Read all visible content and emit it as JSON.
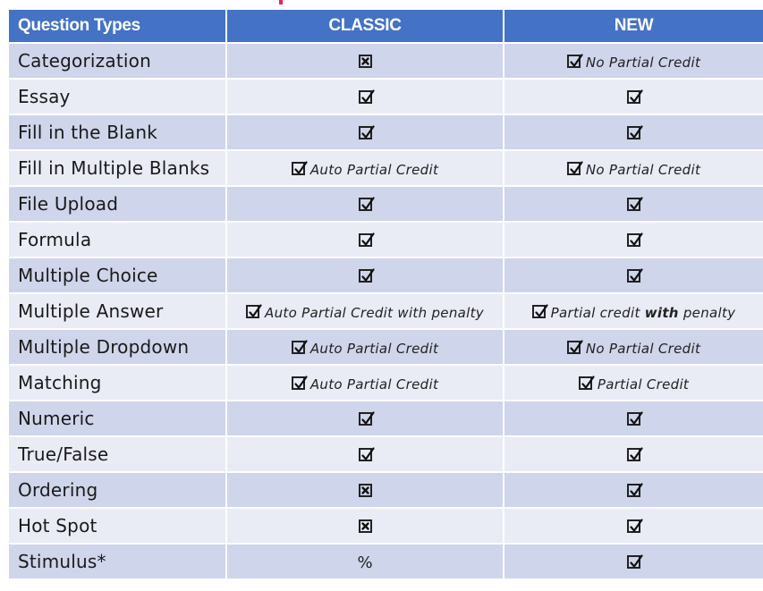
{
  "header": {
    "col_question": "Question Types",
    "col_classic": "CLASSIC",
    "col_new": "NEW"
  },
  "colors": {
    "header_bg": "#4472c4",
    "row_odd": "#cfd5ea",
    "row_even": "#e9ebf5",
    "title_accent": "#e8245a"
  },
  "icons": {
    "supported": "check-box-icon",
    "unsupported": "x-box-icon"
  },
  "rows": [
    {
      "name": "Categorization",
      "classic": {
        "mark": "x",
        "note": ""
      },
      "new": {
        "mark": "check",
        "note": "No Partial Credit"
      }
    },
    {
      "name": "Essay",
      "classic": {
        "mark": "check",
        "note": ""
      },
      "new": {
        "mark": "check",
        "note": ""
      }
    },
    {
      "name": "Fill in the Blank",
      "classic": {
        "mark": "check",
        "note": ""
      },
      "new": {
        "mark": "check",
        "note": ""
      }
    },
    {
      "name": "Fill in Multiple Blanks",
      "classic": {
        "mark": "check",
        "note": "Auto Partial Credit"
      },
      "new": {
        "mark": "check",
        "note": "No Partial Credit"
      }
    },
    {
      "name": "File Upload",
      "classic": {
        "mark": "check",
        "note": ""
      },
      "new": {
        "mark": "check",
        "note": ""
      }
    },
    {
      "name": "Formula",
      "classic": {
        "mark": "check",
        "note": ""
      },
      "new": {
        "mark": "check",
        "note": ""
      }
    },
    {
      "name": "Multiple Choice",
      "classic": {
        "mark": "check",
        "note": ""
      },
      "new": {
        "mark": "check",
        "note": ""
      }
    },
    {
      "name": "Multiple Answer",
      "classic": {
        "mark": "check",
        "note": "Auto Partial Credit with penalty"
      },
      "new": {
        "mark": "check",
        "note_pre": "Partial credit ",
        "note_bold": "with",
        "note_post": " penalty"
      }
    },
    {
      "name": "Multiple Dropdown",
      "classic": {
        "mark": "check",
        "note": "Auto Partial Credit"
      },
      "new": {
        "mark": "check",
        "note": "No Partial Credit"
      }
    },
    {
      "name": "Matching",
      "classic": {
        "mark": "check",
        "note": "Auto Partial Credit"
      },
      "new": {
        "mark": "check",
        "note": "Partial Credit"
      }
    },
    {
      "name": "Numeric",
      "classic": {
        "mark": "check",
        "note": ""
      },
      "new": {
        "mark": "check",
        "note": ""
      }
    },
    {
      "name": "True/False",
      "classic": {
        "mark": "check",
        "note": ""
      },
      "new": {
        "mark": "check",
        "note": ""
      }
    },
    {
      "name": "Ordering",
      "classic": {
        "mark": "x",
        "note": ""
      },
      "new": {
        "mark": "check",
        "note": ""
      }
    },
    {
      "name": "Hot Spot",
      "classic": {
        "mark": "x",
        "note": ""
      },
      "new": {
        "mark": "check",
        "note": ""
      }
    },
    {
      "name": "Stimulus*",
      "classic": {
        "mark": "text",
        "text": "%"
      },
      "new": {
        "mark": "check",
        "note": ""
      }
    }
  ]
}
